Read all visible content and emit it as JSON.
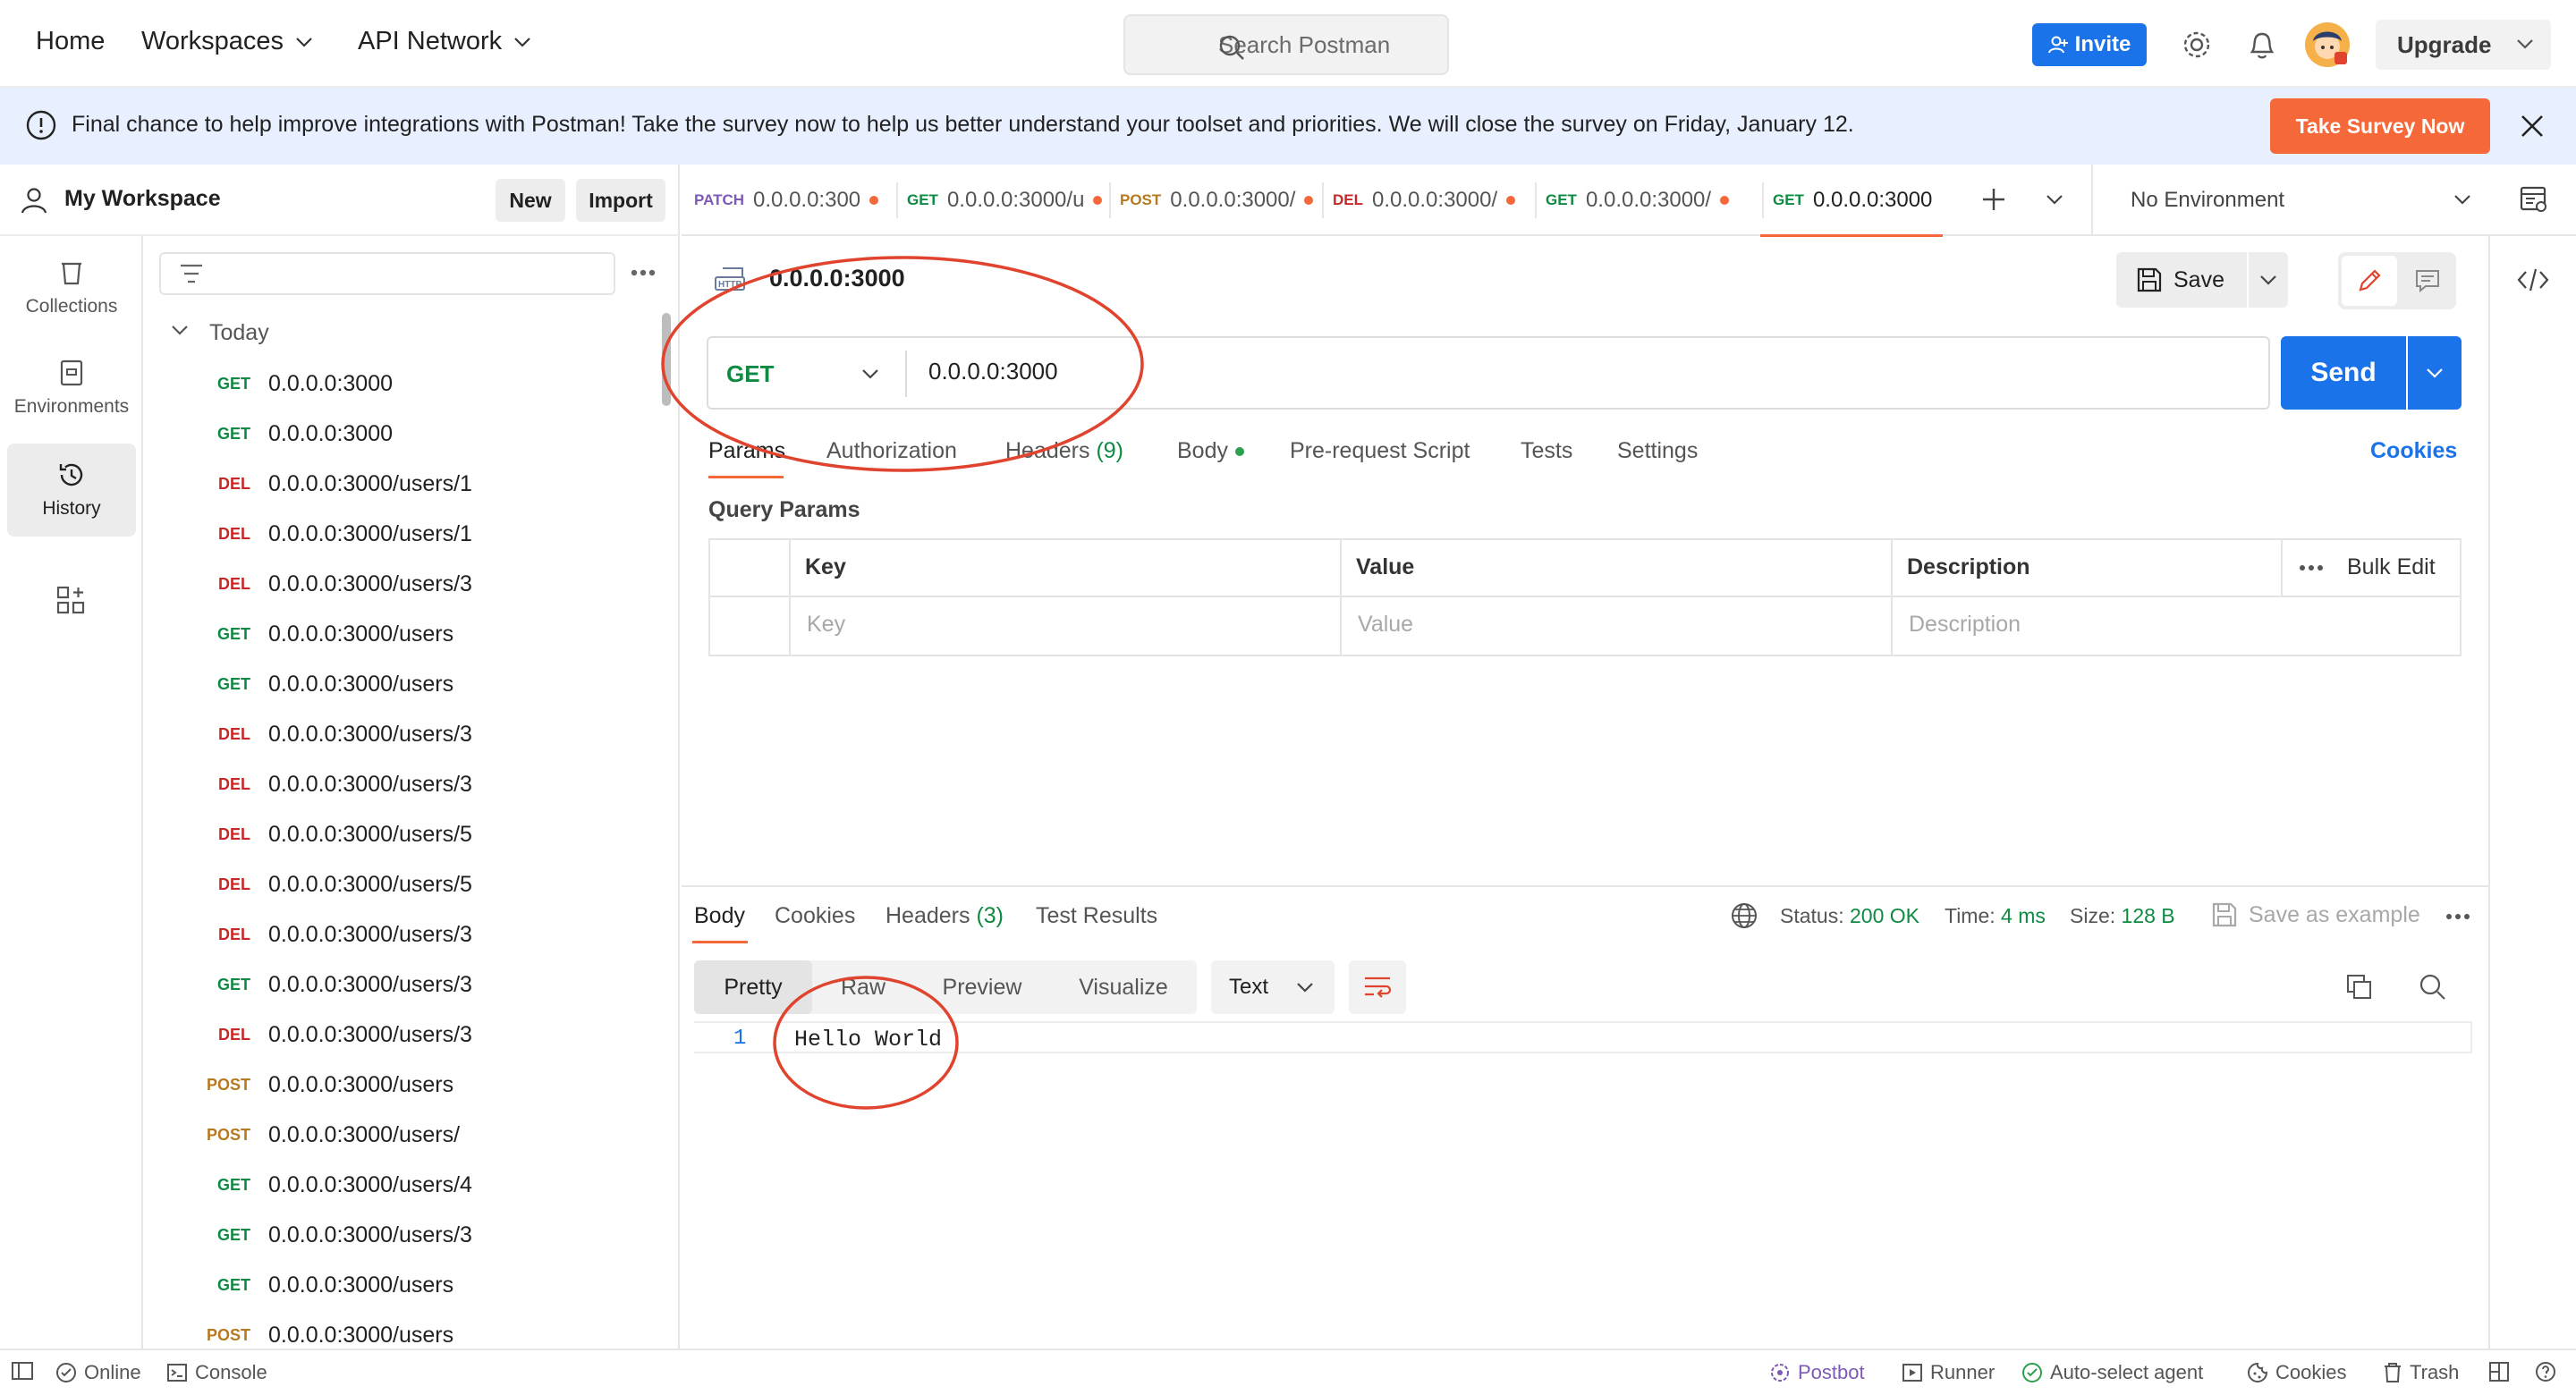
{
  "topbar": {
    "nav": [
      "Home",
      "Workspaces",
      "API Network"
    ],
    "search_placeholder": "Search Postman",
    "invite": "Invite",
    "upgrade": "Upgrade"
  },
  "banner": {
    "text": "Final chance to help improve integrations with Postman! Take the survey now to help us better understand your toolset and priorities. We will close the survey on Friday, January 12.",
    "button": "Take Survey Now"
  },
  "workspace": {
    "name": "My Workspace",
    "new_label": "New",
    "import_label": "Import"
  },
  "rail": {
    "items": [
      "Collections",
      "Environments",
      "History"
    ]
  },
  "history": {
    "group": "Today",
    "items": [
      {
        "method": "GET",
        "url": "0.0.0.0:3000"
      },
      {
        "method": "GET",
        "url": "0.0.0.0:3000"
      },
      {
        "method": "DEL",
        "url": "0.0.0.0:3000/users/1"
      },
      {
        "method": "DEL",
        "url": "0.0.0.0:3000/users/1"
      },
      {
        "method": "DEL",
        "url": "0.0.0.0:3000/users/3"
      },
      {
        "method": "GET",
        "url": "0.0.0.0:3000/users"
      },
      {
        "method": "GET",
        "url": "0.0.0.0:3000/users"
      },
      {
        "method": "DEL",
        "url": "0.0.0.0:3000/users/3"
      },
      {
        "method": "DEL",
        "url": "0.0.0.0:3000/users/3"
      },
      {
        "method": "DEL",
        "url": "0.0.0.0:3000/users/5"
      },
      {
        "method": "DEL",
        "url": "0.0.0.0:3000/users/5"
      },
      {
        "method": "DEL",
        "url": "0.0.0.0:3000/users/3"
      },
      {
        "method": "GET",
        "url": "0.0.0.0:3000/users/3"
      },
      {
        "method": "DEL",
        "url": "0.0.0.0:3000/users/3"
      },
      {
        "method": "POST",
        "url": "0.0.0.0:3000/users"
      },
      {
        "method": "POST",
        "url": "0.0.0.0:3000/users/"
      },
      {
        "method": "GET",
        "url": "0.0.0.0:3000/users/4"
      },
      {
        "method": "GET",
        "url": "0.0.0.0:3000/users/3"
      },
      {
        "method": "GET",
        "url": "0.0.0.0:3000/users"
      },
      {
        "method": "POST",
        "url": "0.0.0.0:3000/users"
      }
    ]
  },
  "tabs": [
    {
      "method": "PATCH",
      "url": "0.0.0.0:300"
    },
    {
      "method": "GET",
      "url": "0.0.0.0:3000/u"
    },
    {
      "method": "POST",
      "url": "0.0.0.0:3000/"
    },
    {
      "method": "DEL",
      "url": "0.0.0.0:3000/"
    },
    {
      "method": "GET",
      "url": "0.0.0.0:3000/"
    },
    {
      "method": "GET",
      "url": "0.0.0.0:3000"
    }
  ],
  "environment": "No Environment",
  "request": {
    "title": "0.0.0.0:3000",
    "save": "Save",
    "method": "GET",
    "url": "0.0.0.0:3000",
    "send": "Send",
    "tabs": {
      "params": "Params",
      "authorization": "Authorization",
      "headers": "Headers",
      "headers_count": "(9)",
      "body": "Body",
      "prerequest": "Pre-request Script",
      "tests": "Tests",
      "settings": "Settings"
    },
    "cookies": "Cookies",
    "query_params_title": "Query Params",
    "table": {
      "key": "Key",
      "value": "Value",
      "description": "Description",
      "bulk_edit": "Bulk Edit",
      "key_placeholder": "Key",
      "value_placeholder": "Value",
      "description_placeholder": "Description"
    }
  },
  "response": {
    "tabs": {
      "body": "Body",
      "cookies": "Cookies",
      "headers": "Headers",
      "headers_count": "(3)",
      "test_results": "Test Results"
    },
    "status_label": "Status:",
    "status_value": "200 OK",
    "time_label": "Time:",
    "time_value": "4 ms",
    "size_label": "Size:",
    "size_value": "128 B",
    "save_example": "Save as example",
    "views": [
      "Pretty",
      "Raw",
      "Preview",
      "Visualize"
    ],
    "format": "Text",
    "line_number": "1",
    "body_text": "Hello World"
  },
  "statusbar": {
    "online": "Online",
    "console": "Console",
    "postbot": "Postbot",
    "runner": "Runner",
    "auto_select": "Auto-select agent",
    "cookies": "Cookies",
    "trash": "Trash"
  },
  "annotation_color": "#e0442f"
}
